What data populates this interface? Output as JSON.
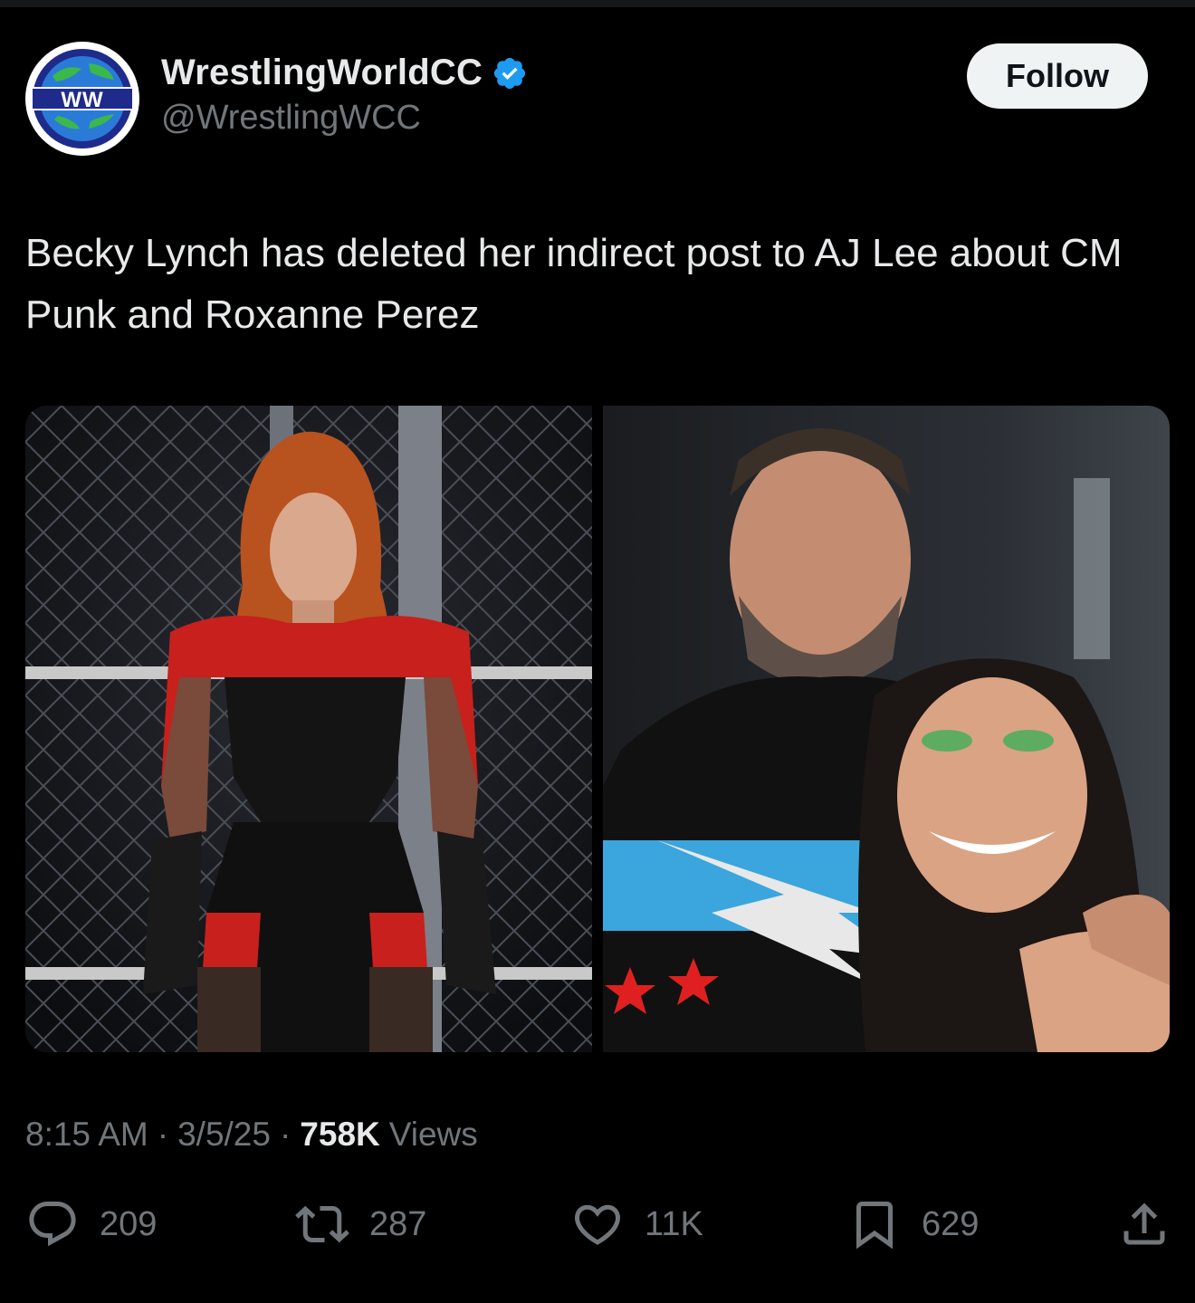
{
  "account": {
    "display_name": "WrestlingWorldCC",
    "handle": "@WrestlingWCC",
    "avatar_logo_text": "WW",
    "verified": true
  },
  "follow_label": "Follow",
  "tweet": {
    "text": "Becky Lynch has deleted her indirect post to AJ Lee about CM Punk and Roxanne Perez"
  },
  "meta": {
    "time": "8:15 AM",
    "sep1": "·",
    "date": "3/5/25",
    "sep2": "·",
    "views_count": "758K",
    "views_label": "Views"
  },
  "actions": {
    "replies": "209",
    "reposts": "287",
    "likes": "11K",
    "bookmarks": "629"
  },
  "colors": {
    "background": "#000000",
    "text": "#e7e9ea",
    "muted": "#71767b",
    "verified": "#1d9bf0"
  }
}
